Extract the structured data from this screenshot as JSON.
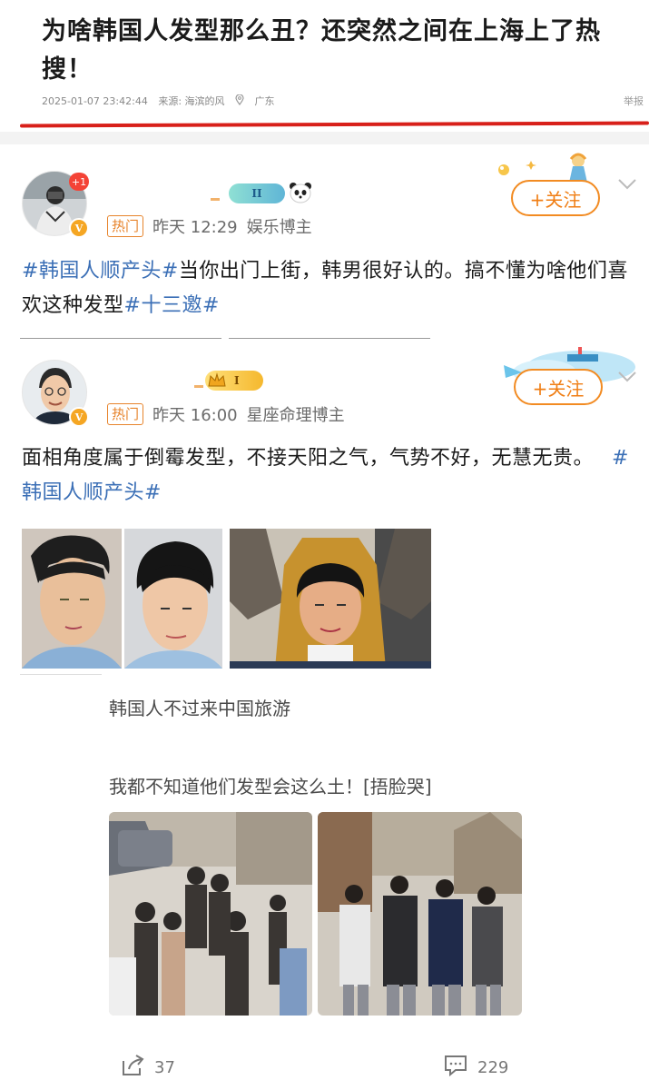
{
  "article": {
    "title": "为啥韩国人发型那么丑？还突然之间在上海上了热搜！",
    "datetime": "2025-01-07 23:42:44",
    "source": "来源: 海滨的风",
    "location": "广东",
    "report_label": "举报"
  },
  "posts": [
    {
      "notification_count": "+1",
      "level_badge": "II",
      "hot_tag": "热门",
      "time": "昨天 12:29",
      "category": "娱乐博主",
      "follow_label": "+关注",
      "topic1": "#韩国人顺产头#",
      "body": "当你出门上街，韩男很好认的。搞不懂为啥他们喜欢这种发型",
      "topic2": "#十三邀#"
    },
    {
      "level_badge": "I",
      "hot_tag": "热门",
      "time": "昨天 16:00",
      "category": "星座命理博主",
      "follow_label": "+关注",
      "body": "面相角度属于倒霉发型，不接天阳之气，气势不好，无慧无贵。",
      "topic1": "#韩国人顺产头#"
    },
    {
      "line1": "韩国人不过来中国旅游",
      "line2": "我都不知道他们发型会这么土！[捂脸哭]",
      "share_count": "37",
      "comment_count": "229"
    }
  ],
  "colors": {
    "accent_orange": "#f28b22",
    "topic_blue": "#3b6fb6",
    "underline_red": "#d8201a"
  }
}
